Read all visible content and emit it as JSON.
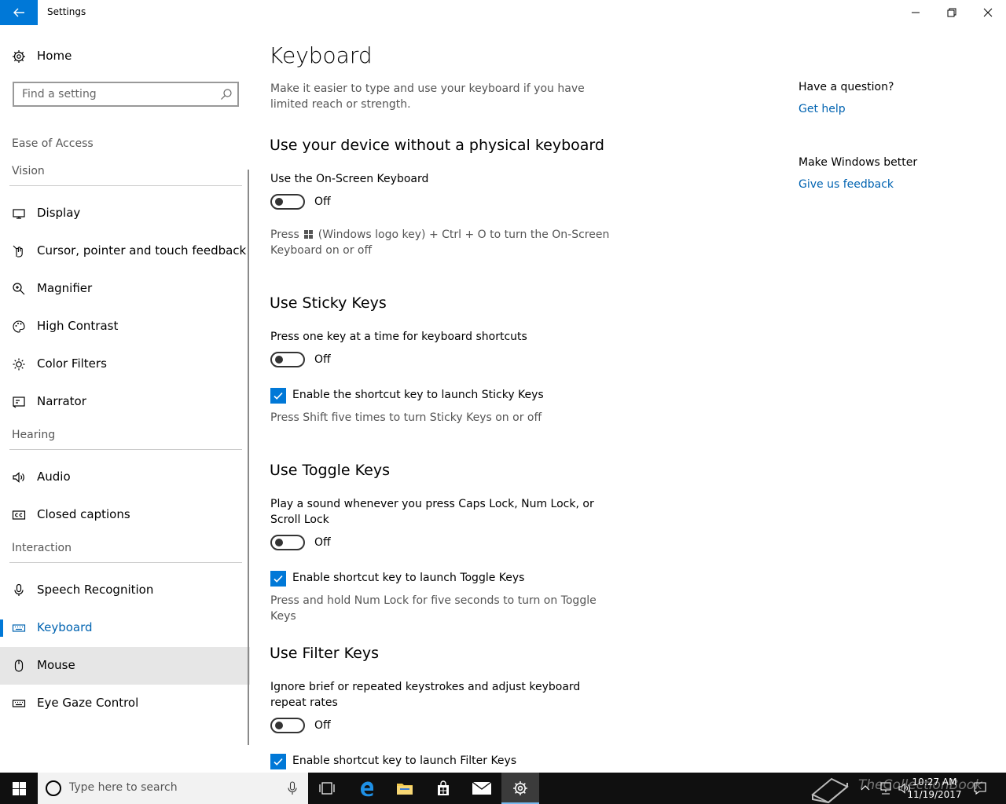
{
  "window": {
    "title": "Settings"
  },
  "sidebar": {
    "home_label": "Home",
    "search_placeholder": "Find a setting",
    "breadcrumb": "Ease of Access",
    "groups": {
      "vision": "Vision",
      "hearing": "Hearing",
      "interaction": "Interaction"
    },
    "items": {
      "display": "Display",
      "cursor": "Cursor, pointer and touch feedback",
      "magnifier": "Magnifier",
      "high_contrast": "High Contrast",
      "color_filters": "Color Filters",
      "narrator": "Narrator",
      "audio": "Audio",
      "closed_captions": "Closed captions",
      "speech": "Speech Recognition",
      "keyboard": "Keyboard",
      "mouse": "Mouse",
      "eye_gaze": "Eye Gaze Control"
    },
    "selected": "Keyboard"
  },
  "main": {
    "title": "Keyboard",
    "description": "Make it easier to type and use your keyboard if you have limited reach or strength.",
    "sections": {
      "osk": {
        "heading": "Use your device without a physical keyboard",
        "setting_label": "Use the On-Screen Keyboard",
        "state": "Off",
        "hint_before": "Press",
        "hint_after": "(Windows logo key) + Ctrl + O to turn the On-Screen Keyboard on or off"
      },
      "sticky": {
        "heading": "Use Sticky Keys",
        "setting_label": "Press one key at a time for keyboard shortcuts",
        "state": "Off",
        "checkbox_label": "Enable the shortcut key to launch Sticky Keys",
        "checkbox_checked": true,
        "hint": "Press Shift five times to turn Sticky Keys on or off"
      },
      "toggle": {
        "heading": "Use Toggle Keys",
        "setting_label": "Play a sound whenever you press Caps Lock, Num Lock, or Scroll Lock",
        "state": "Off",
        "checkbox_label": "Enable shortcut key to launch Toggle Keys",
        "checkbox_checked": true,
        "hint": "Press and hold Num Lock for five seconds to turn on Toggle Keys"
      },
      "filter": {
        "heading": "Use Filter Keys",
        "setting_label": "Ignore brief or repeated keystrokes and adjust keyboard repeat rates",
        "state": "Off",
        "checkbox_label": "Enable shortcut key to launch Filter Keys",
        "checkbox_checked": true
      }
    }
  },
  "aside": {
    "question_title": "Have a question?",
    "get_help": "Get help",
    "better_title": "Make Windows better",
    "feedback": "Give us feedback"
  },
  "taskbar": {
    "search_placeholder": "Type here to search",
    "time": "10:27 AM",
    "date": "11/19/2017",
    "watermark": "TheCollectionBook"
  },
  "colors": {
    "accent": "#0078d7",
    "link": "#0063b1",
    "taskbar": "#101010"
  },
  "icons": {
    "back": "arrow-left-icon",
    "home": "gear-icon",
    "search": "magnifier-icon",
    "start": "windows-logo-icon"
  }
}
